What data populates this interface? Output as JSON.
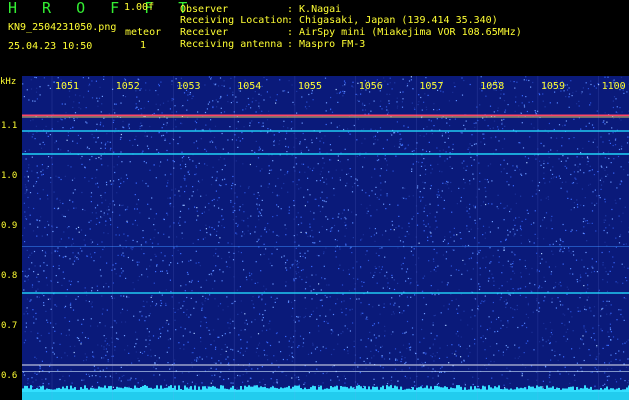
{
  "header": {
    "brand": "H R O F F T",
    "version": "1.00f",
    "filename": "KN9_2504231050.png",
    "meteor_label": "meteor",
    "meteor_count": "1",
    "datetime": "25.04.23 10:50"
  },
  "info": [
    {
      "key": "Observer",
      "value": ": K.Nagai"
    },
    {
      "key": "Receiving Location",
      "value": ": Chigasaki, Japan (139.414 35.340)"
    },
    {
      "key": "Receiver",
      "value": ": AirSpy mini (Miakejima VOR 108.65MHz)"
    },
    {
      "key": "Receiving antenna",
      "value": ": Maspro FM-3"
    }
  ],
  "spectrogram": {
    "y_unit": "kHz",
    "y_ticks": [
      "1.1",
      "1.0",
      "0.9",
      "0.8",
      "0.7",
      "0.6"
    ],
    "time_labels": [
      "1051",
      "1052",
      "1053",
      "1054",
      "1055",
      "1056",
      "1057",
      "1058",
      "1059",
      "1100"
    ],
    "colors": {
      "background": "#0a1a7a",
      "noise": "#3a6aff",
      "signal": "#22ddff",
      "hot": "#ff4466"
    }
  }
}
